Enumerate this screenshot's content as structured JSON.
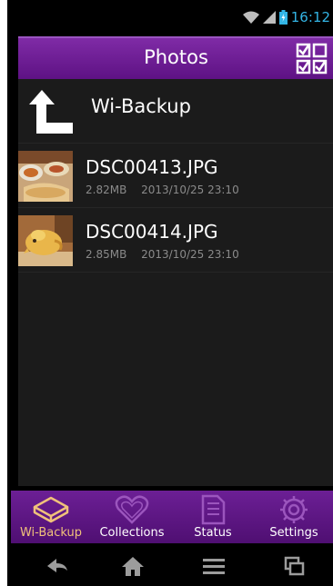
{
  "status_bar": {
    "time": "16:12"
  },
  "header": {
    "title": "Photos"
  },
  "back_row": {
    "label": "Wi-Backup"
  },
  "files": [
    {
      "name": "DSC00413.JPG",
      "size": "2.82MB",
      "date": "2013/10/25 23:10"
    },
    {
      "name": "DSC00414.JPG",
      "size": "2.85MB",
      "date": "2013/10/25 23:10"
    }
  ],
  "tabs": [
    {
      "label": "Wi-Backup",
      "icon": "drive-icon",
      "active": true
    },
    {
      "label": "Collections",
      "icon": "heart-icon",
      "active": false
    },
    {
      "label": "Status",
      "icon": "document-icon",
      "active": false
    },
    {
      "label": "Settings",
      "icon": "gear-icon",
      "active": false
    }
  ],
  "colors": {
    "accent": "#6c1f95",
    "active_tab": "#f0c27a",
    "clock": "#33b5e5"
  }
}
